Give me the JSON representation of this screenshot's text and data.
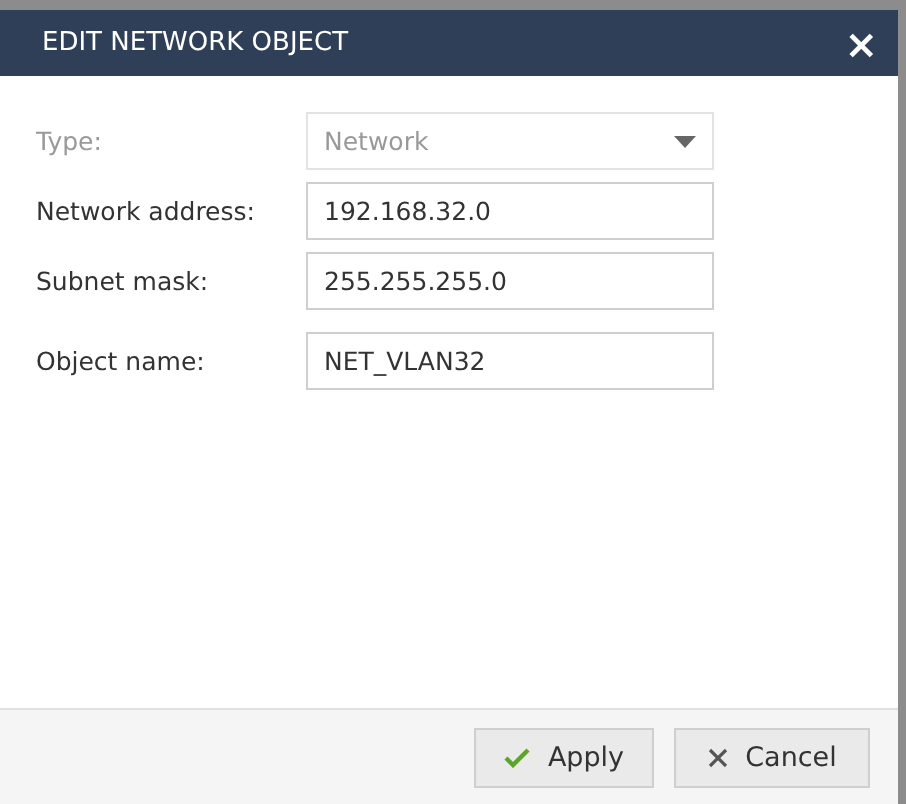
{
  "dialog": {
    "title": "EDIT NETWORK OBJECT",
    "close": "×"
  },
  "fields": [
    {
      "kind": "select",
      "label": "Type:",
      "value": "Network",
      "disabled": true
    },
    {
      "kind": "text",
      "label": "Network address:",
      "value": "192.168.32.0",
      "disabled": false
    },
    {
      "kind": "text",
      "label": "Subnet mask:",
      "value": "255.255.255.0",
      "disabled": false
    },
    {
      "kind": "text",
      "label": "Object name:",
      "value": "NET_VLAN32",
      "disabled": false
    }
  ],
  "buttons": [
    {
      "kind": "apply",
      "label": "Apply"
    },
    {
      "kind": "cancel",
      "label": "Cancel"
    }
  ]
}
